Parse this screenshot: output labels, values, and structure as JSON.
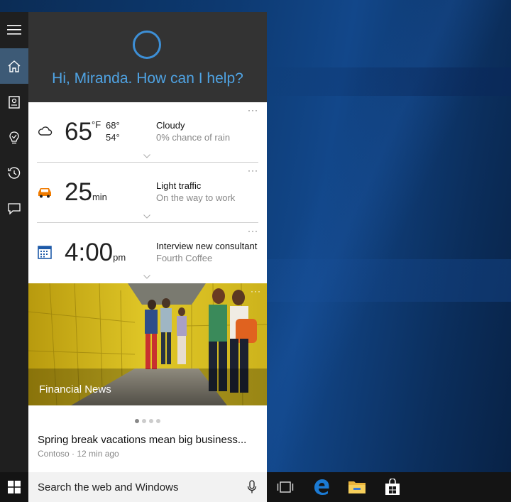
{
  "header": {
    "greeting": "Hi, Miranda. How can I help?"
  },
  "weather": {
    "temp": "65",
    "unit": "°F",
    "high": "68°",
    "low": "54°",
    "condition": "Cloudy",
    "detail": "0% chance of rain",
    "more": "···"
  },
  "traffic": {
    "value": "25",
    "unit": "min",
    "condition": "Light traffic",
    "detail": "On the way to work",
    "more": "···"
  },
  "calendar": {
    "time": "4:00",
    "ampm": "pm",
    "title": "Interview new consultant",
    "detail": "Fourth Coffee",
    "more": "···"
  },
  "news": {
    "category": "Financial News",
    "more": "···",
    "headline": "Spring break vacations mean big business...",
    "meta": "Contoso · 12 min ago",
    "pager_total": 4,
    "pager_active": 1
  },
  "search": {
    "text": "Search the web and Windows"
  },
  "icons": {
    "hamburger": "hamburger-menu-icon",
    "home": "home-icon",
    "notebook": "notebook-icon",
    "reminders": "lightbulb-icon",
    "history": "history-icon",
    "feedback": "feedback-icon",
    "weather": "cloud-icon",
    "traffic": "car-icon",
    "calendar": "calendar-icon",
    "mic": "microphone-icon",
    "start": "windows-logo-icon",
    "taskview": "task-view-icon",
    "edge": "edge-icon",
    "explorer": "file-explorer-icon",
    "store": "store-icon"
  },
  "colors": {
    "accent": "#3d8fd6",
    "greeting": "#4fa3e3",
    "rail_active": "#3d5a76",
    "header_bg": "#333333"
  }
}
